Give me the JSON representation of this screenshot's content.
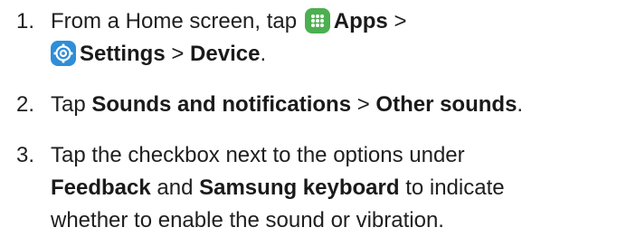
{
  "steps": [
    {
      "number": "1.",
      "line1_prefix": "From a Home screen, tap",
      "apps_label": "Apps",
      "sep1": ">",
      "settings_label": "Settings",
      "sep2": ">",
      "device_label": "Device",
      "end": "."
    },
    {
      "number": "2.",
      "prefix": "Tap",
      "sounds_label": "Sounds and notifications",
      "sep": ">",
      "other_label": "Other sounds",
      "end": "."
    },
    {
      "number": "3.",
      "line1": "Tap the checkbox next to the options under",
      "feedback_label": "Feedback",
      "and_text": "and",
      "keyboard_label": "Samsung keyboard",
      "line2_suffix": "to indicate",
      "line3": "whether to enable the sound or vibration."
    }
  ],
  "icons": {
    "apps": "apps-icon",
    "settings": "settings-icon",
    "apps_color": "#4caf50",
    "settings_color": "#2e8ed8"
  }
}
